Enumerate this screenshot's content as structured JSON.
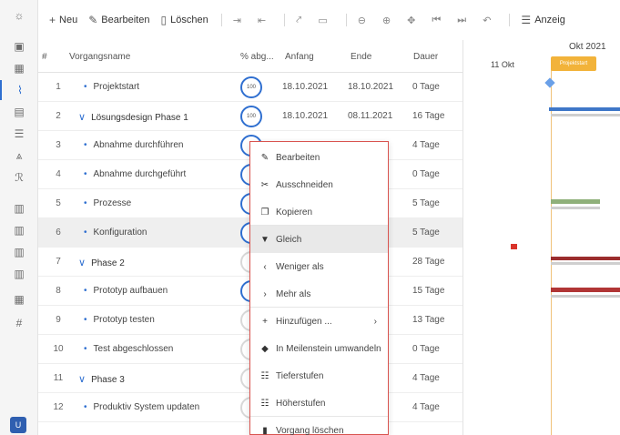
{
  "toolbar": {
    "new": "Neu",
    "edit": "Bearbeiten",
    "delete": "Löschen",
    "view": "Anzeig"
  },
  "grid": {
    "headers": {
      "id": "#",
      "name": "Vorgangsname",
      "percent": "% abg...",
      "start": "Anfang",
      "end": "Ende",
      "duration": "Dauer"
    },
    "rows": [
      {
        "num": "1",
        "name": "Projektstart",
        "type": "child",
        "pct": "100",
        "start": "18.10.2021",
        "end": "18.10.2021",
        "dur": "0 Tage"
      },
      {
        "num": "2",
        "name": "Lösungsdesign Phase 1",
        "type": "parent",
        "pct": "100",
        "start": "18.10.2021",
        "end": "08.11.2021",
        "dur": "16 Tage"
      },
      {
        "num": "3",
        "name": "Abnahme durchführen",
        "type": "child",
        "pct": "",
        "start": "",
        "end": "",
        "dur": "4 Tage"
      },
      {
        "num": "4",
        "name": "Abnahme durchgeführt",
        "type": "child",
        "pct": "",
        "start": "",
        "end": "",
        "dur": "0 Tage"
      },
      {
        "num": "5",
        "name": "Prozesse",
        "type": "child",
        "pct": "",
        "start": "",
        "end": "",
        "dur": "5 Tage"
      },
      {
        "num": "6",
        "name": "Konfiguration",
        "type": "child",
        "pct": "",
        "start": "",
        "end": "",
        "dur": "5 Tage"
      },
      {
        "num": "7",
        "name": "Phase 2",
        "type": "parent",
        "pct": "",
        "start": "",
        "end": "",
        "dur": "28 Tage"
      },
      {
        "num": "8",
        "name": "Prototyp aufbauen",
        "type": "child",
        "pct": "",
        "start": "",
        "end": "",
        "dur": "15 Tage"
      },
      {
        "num": "9",
        "name": "Prototyp testen",
        "type": "child",
        "pct": "",
        "start": "",
        "end": "",
        "dur": "13 Tage"
      },
      {
        "num": "10",
        "name": "Test abgeschlossen",
        "type": "child",
        "pct": "",
        "start": "",
        "end": "",
        "dur": "0 Tage"
      },
      {
        "num": "11",
        "name": "Phase 3",
        "type": "parent",
        "pct": "",
        "start": "",
        "end": "",
        "dur": "4 Tage"
      },
      {
        "num": "12",
        "name": "Produktiv System updaten",
        "type": "child",
        "pct": "",
        "start": "",
        "end": "",
        "dur": "4 Tage"
      }
    ]
  },
  "gantt": {
    "month": "Okt 2021",
    "day": "11 Okt",
    "milestone": "Projektstart"
  },
  "context_menu": {
    "items": [
      {
        "label": "Bearbeiten",
        "icon": "pencil-icon"
      },
      {
        "label": "Ausschneiden",
        "icon": "scissors-icon"
      },
      {
        "label": "Kopieren",
        "icon": "copy-icon"
      },
      {
        "label": "Gleich",
        "icon": "filter-icon"
      },
      {
        "label": "Weniger als",
        "icon": "chevron-left-icon"
      },
      {
        "label": "Mehr als",
        "icon": "chevron-right-icon"
      },
      {
        "label": "Hinzufügen ...",
        "icon": "plus-icon"
      },
      {
        "label": "In Meilenstein umwandeln",
        "icon": "diamond-icon"
      },
      {
        "label": "Tieferstufen",
        "icon": "indent-icon"
      },
      {
        "label": "Höherstufen",
        "icon": "outdent-icon"
      },
      {
        "label": "Vorgang löschen",
        "icon": "trash-icon"
      }
    ]
  },
  "user": {
    "initial": "U"
  },
  "colors": {
    "accent": "#2f6fd0",
    "menu_border": "#d9534f",
    "milestone": "#f2b33a"
  }
}
